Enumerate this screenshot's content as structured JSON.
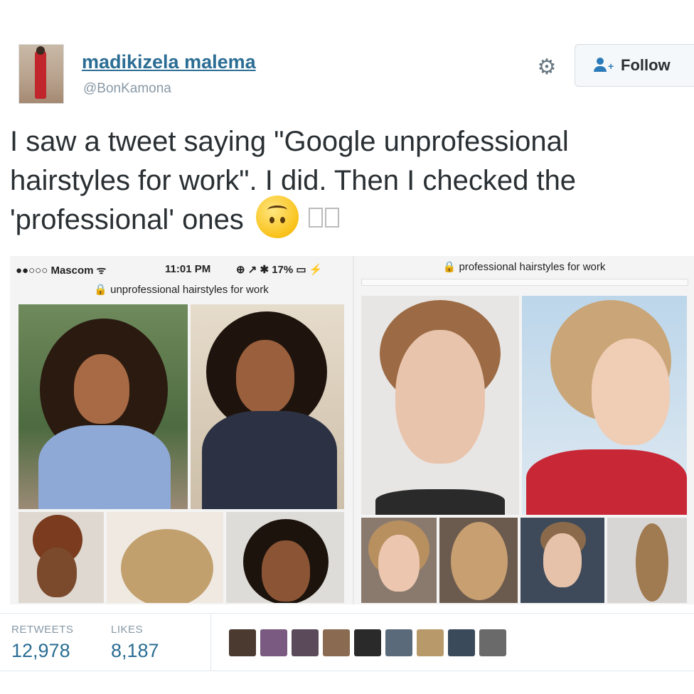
{
  "user": {
    "name": "madikizela malema",
    "handle": "@BonKamona"
  },
  "actions": {
    "follow_label": "Follow",
    "settings_icon": "gear-icon",
    "follow_icon": "follow-person-icon"
  },
  "tweet": {
    "text": "I saw a tweet saying \"Google unprofessional hairstyles for work\". I did. Then I checked the 'professional' ones",
    "emoji": "upside-down-face-icon"
  },
  "screenshot_left": {
    "carrier": "●●○○○ Mascom ᯤ",
    "time": "11:01 PM",
    "status_right": "⊕ ↗ ✱ 17% ▭ ⚡",
    "url": "🔒 unprofessional hairstyles for work"
  },
  "screenshot_right": {
    "url": "🔒 professional hairstyles for work"
  },
  "stats": {
    "retweets_label": "RETWEETS",
    "retweets": "12,978",
    "likes_label": "LIKES",
    "likes": "8,187"
  },
  "colors": {
    "link": "#2b6d94",
    "muted": "#8899a6",
    "follow_blue": "#2b7bb9"
  }
}
